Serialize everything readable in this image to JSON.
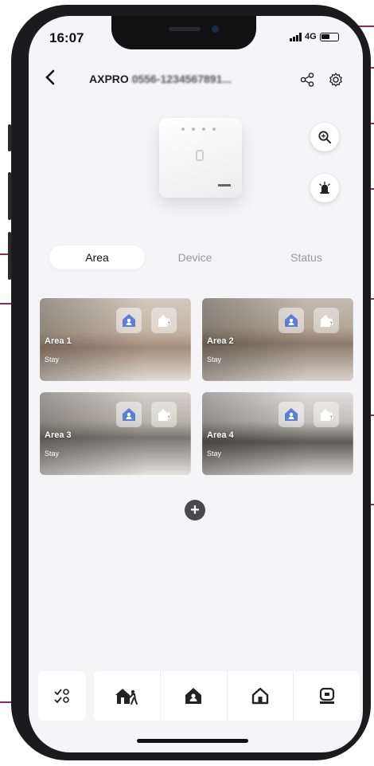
{
  "status_bar": {
    "time": "16:07",
    "network": "4G"
  },
  "header": {
    "title_prefix": "AXPRO",
    "serial": "0556-1234567891..."
  },
  "tabs": [
    {
      "label": "Area",
      "active": true
    },
    {
      "label": "Device",
      "active": false
    },
    {
      "label": "Status",
      "active": false
    }
  ],
  "areas": [
    {
      "name": "Area 1",
      "mode": "Stay"
    },
    {
      "name": "Area 2",
      "mode": "Stay"
    },
    {
      "name": "Area 3",
      "mode": "Stay"
    },
    {
      "name": "Area 4",
      "mode": "Stay"
    }
  ],
  "icons": {
    "back": "back-arrow-icon",
    "share": "share-icon",
    "settings": "gear-icon",
    "search": "magnifier-icon",
    "alarm": "siren-icon",
    "add": "plus-icon",
    "select": "multi-select-icon",
    "stay_arm": "stay-arm-icon",
    "away_arm": "away-arm-icon",
    "disarm": "disarm-icon",
    "clear_alarm": "clear-alarm-icon"
  },
  "colors": {
    "accent_blue": "#5b7fd6",
    "annotation": "#8b2a5c"
  }
}
